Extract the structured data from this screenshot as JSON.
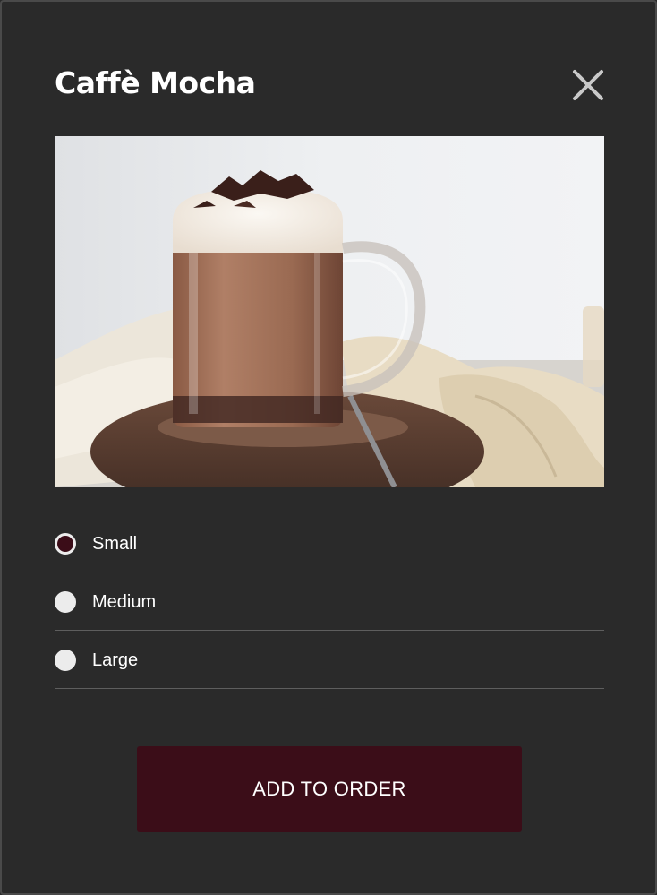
{
  "modal": {
    "title": "Caffè Mocha",
    "close_icon": "close-icon",
    "image_alt": "Mug of caffè mocha topped with foam and chocolate shavings"
  },
  "size_options": [
    {
      "label": "Small",
      "selected": true
    },
    {
      "label": "Medium",
      "selected": false
    },
    {
      "label": "Large",
      "selected": false
    }
  ],
  "add_button_label": "ADD TO ORDER",
  "colors": {
    "background": "#2a2a2a",
    "accent": "#3b0d18",
    "text": "#ffffff",
    "divider": "#5e5e5e"
  }
}
